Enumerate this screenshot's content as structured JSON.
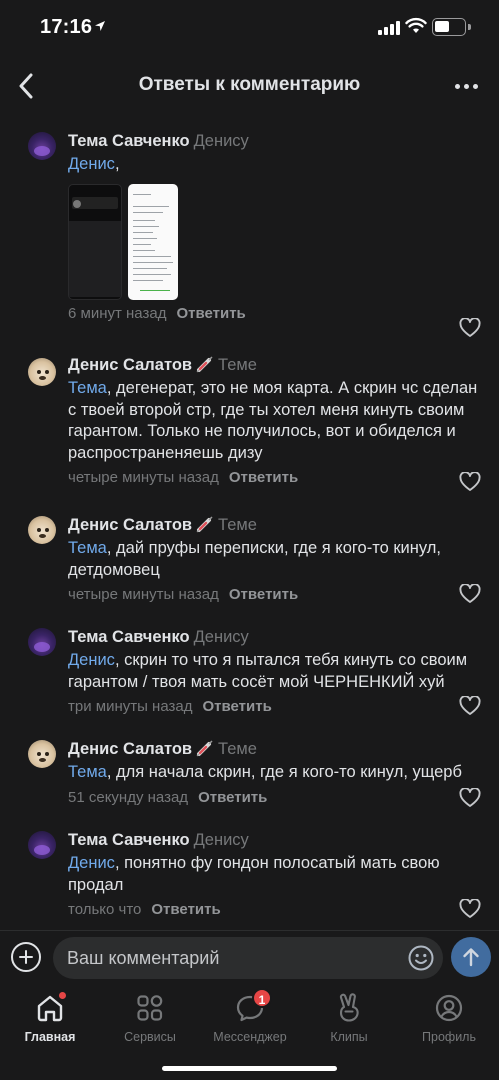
{
  "status_bar": {
    "time": "17:16"
  },
  "header": {
    "title": "Ответы к комментарию"
  },
  "comments": [
    {
      "author": "Тема Савченко",
      "to": "Денису",
      "mention": "Денис",
      "text": ",",
      "time": "6 минут назад",
      "reply": "Ответить",
      "has_badge_emoji": false
    },
    {
      "author": "Денис Салатов",
      "to": "Теме",
      "mention": "Тема",
      "text": ", дегенерат, это не моя карта. А скрин чс сделан с твоей второй стр, где ты хотел меня кинуть своим гарантом. Только не получилось, вот и обиделся и распространеняешь дизу",
      "time": "четыре минуты назад",
      "reply": "Ответить",
      "has_badge_emoji": true
    },
    {
      "author": "Денис Салатов",
      "to": "Теме",
      "mention": "Тема",
      "text": ", дай пруфы переписки, где я кого-то кинул, детдомовец",
      "time": "четыре минуты назад",
      "reply": "Ответить",
      "has_badge_emoji": true
    },
    {
      "author": "Тема Савченко",
      "to": "Денису",
      "mention": "Денис",
      "text": ", скрин то что я пытался тебя кинуть со своим гарантом / твоя мать сосёт мой ЧЕРНЕНКИЙ хуй",
      "time": "три минуты назад",
      "reply": "Ответить",
      "has_badge_emoji": false
    },
    {
      "author": "Денис Салатов",
      "to": "Теме",
      "mention": "Тема",
      "text": ", для начала скрин, где я кого-то кинул, ущерб",
      "time": "51 секунду назад",
      "reply": "Ответить",
      "has_badge_emoji": true
    },
    {
      "author": "Тема Савченко",
      "to": "Денису",
      "mention": "Денис",
      "text": ", понятно фу гондон полосатый мать свою продал",
      "time": "только что",
      "reply": "Ответить",
      "has_badge_emoji": false
    }
  ],
  "input": {
    "placeholder": "Ваш комментарий"
  },
  "tabs": [
    {
      "label": "Главная",
      "icon": "home-icon"
    },
    {
      "label": "Сервисы",
      "icon": "services-icon"
    },
    {
      "label": "Мессенджер",
      "icon": "messenger-icon",
      "badge": "1"
    },
    {
      "label": "Клипы",
      "icon": "clips-icon"
    },
    {
      "label": "Профиль",
      "icon": "profile-icon"
    }
  ],
  "colors": {
    "background": "#19191a",
    "accent": "#71aaeb",
    "send": "#416c9f",
    "badge": "#e64646"
  }
}
